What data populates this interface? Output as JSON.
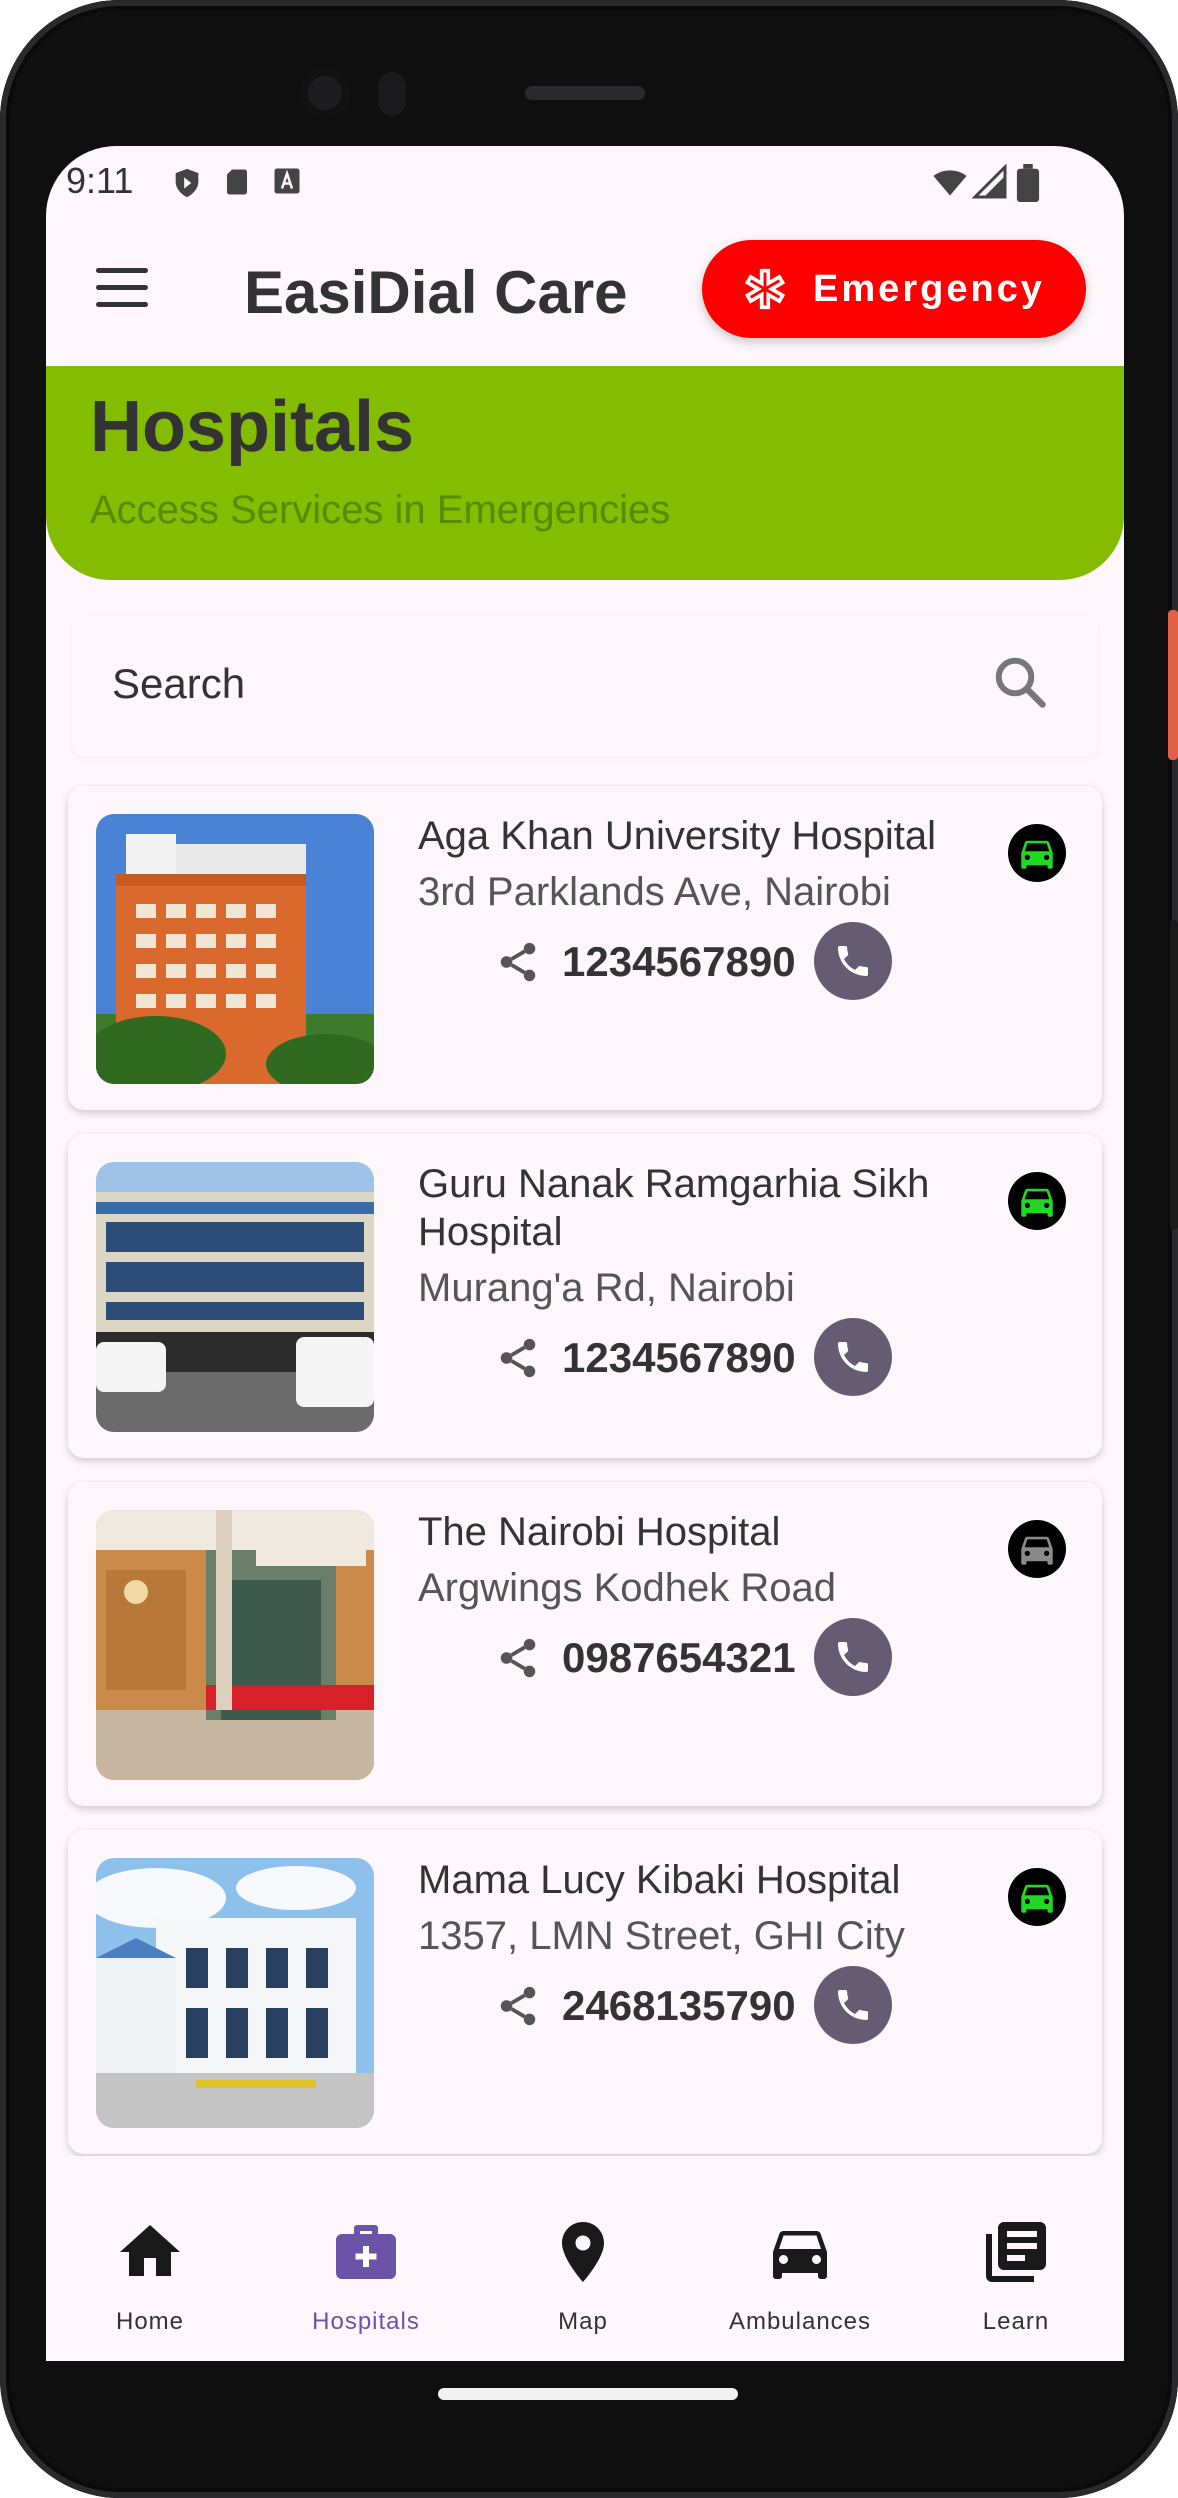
{
  "status_bar": {
    "time": "9:11",
    "left_icons": [
      "shield-icon",
      "sd-card-icon",
      "font-icon"
    ],
    "right_icons": [
      "wifi-icon",
      "cellular-icon",
      "battery-icon"
    ]
  },
  "app_bar": {
    "title": "EasiDial Care",
    "menu_icon": "hamburger-menu-icon",
    "emergency_label": "Emergency",
    "emergency_color": "#ff0000"
  },
  "hero": {
    "title": "Hospitals",
    "subtitle": "Access Services in Emergencies",
    "background": "#83bc00"
  },
  "search": {
    "placeholder": "Search"
  },
  "hospitals": [
    {
      "name": "Aga Khan University Hospital",
      "address": "3rd Parklands Ave, Nairobi",
      "phone": "1234567890",
      "ambulance_available": true
    },
    {
      "name": "Guru Nanak Ramgarhia Sikh Hospital",
      "address": "Murang'a Rd, Nairobi",
      "phone": "1234567890",
      "ambulance_available": true
    },
    {
      "name": "The Nairobi Hospital",
      "address": " Argwings Kodhek Road",
      "phone": "0987654321",
      "ambulance_available": false
    },
    {
      "name": "Mama Lucy Kibaki Hospital",
      "address": "1357, LMN Street, GHI City",
      "phone": "2468135790",
      "ambulance_available": true
    }
  ],
  "nav": {
    "items": [
      {
        "label": "Home",
        "icon": "home-icon",
        "active": false
      },
      {
        "label": "Hospitals",
        "icon": "medical-bag-icon",
        "active": true
      },
      {
        "label": "Map",
        "icon": "map-pin-icon",
        "active": false
      },
      {
        "label": "Ambulances",
        "icon": "car-icon",
        "active": false
      },
      {
        "label": "Learn",
        "icon": "library-icon",
        "active": false
      }
    ],
    "active_color": "#6b53a8"
  }
}
